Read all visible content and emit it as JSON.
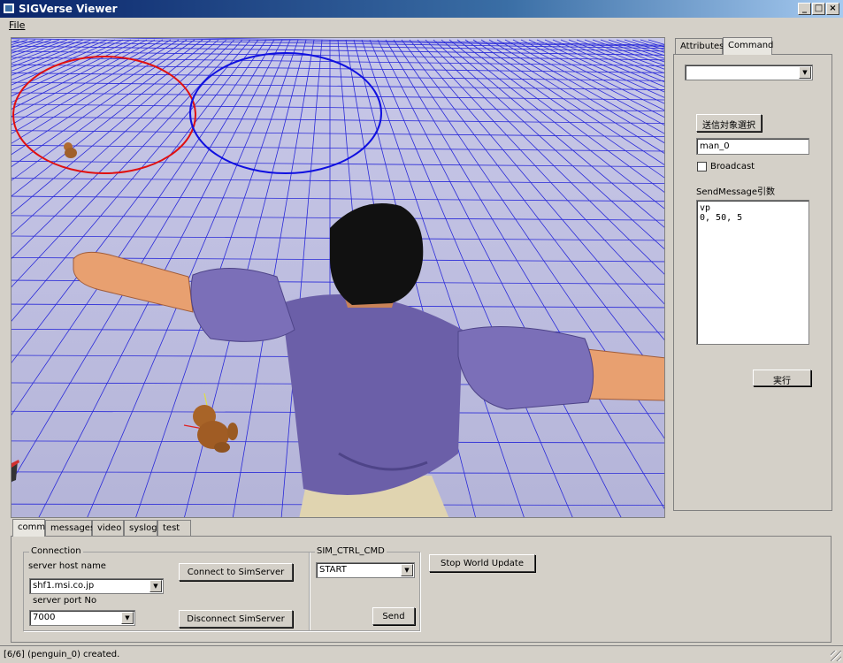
{
  "window": {
    "title": "SIGVerse Viewer",
    "minimize": "_",
    "maximize": "□",
    "close": "×"
  },
  "menu": {
    "file": "File"
  },
  "right_panel": {
    "tabs": [
      {
        "label": "Attributes",
        "active": false
      },
      {
        "label": "Command",
        "active": true
      }
    ],
    "command_combo_value": "",
    "select_target_button": "送信対象選択",
    "target_value": "man_0",
    "broadcast_label": "Broadcast",
    "broadcast_checked": false,
    "sendmessage_label": "SendMessage引数",
    "sendmessage_value": "vp\n0, 50, 5",
    "execute_button": "実行"
  },
  "bottom_panel": {
    "tabs": [
      {
        "label": "comm",
        "active": true
      },
      {
        "label": "messages"
      },
      {
        "label": "video"
      },
      {
        "label": "syslog"
      },
      {
        "label": "test"
      }
    ],
    "connection": {
      "title": "Connection",
      "host_label": "server host name",
      "host_value": "shf1.msi.co.jp",
      "port_label": "server port No",
      "port_value": "7000",
      "connect_button": "Connect to SimServer",
      "disconnect_button": "Disconnect SimServer"
    },
    "sim_ctrl": {
      "title": "SIM_CTRL_CMD",
      "value": "START",
      "send_button": "Send"
    },
    "stop_world_button": "Stop World Update"
  },
  "status": {
    "text": "[6/6] (penguin_0) created."
  },
  "colors": {
    "grid_line": "#2a2ad8",
    "red_circle": "#e01010",
    "blue_circle": "#1010e0",
    "shirt": "#6b5fa8",
    "skin": "#e8a070"
  }
}
